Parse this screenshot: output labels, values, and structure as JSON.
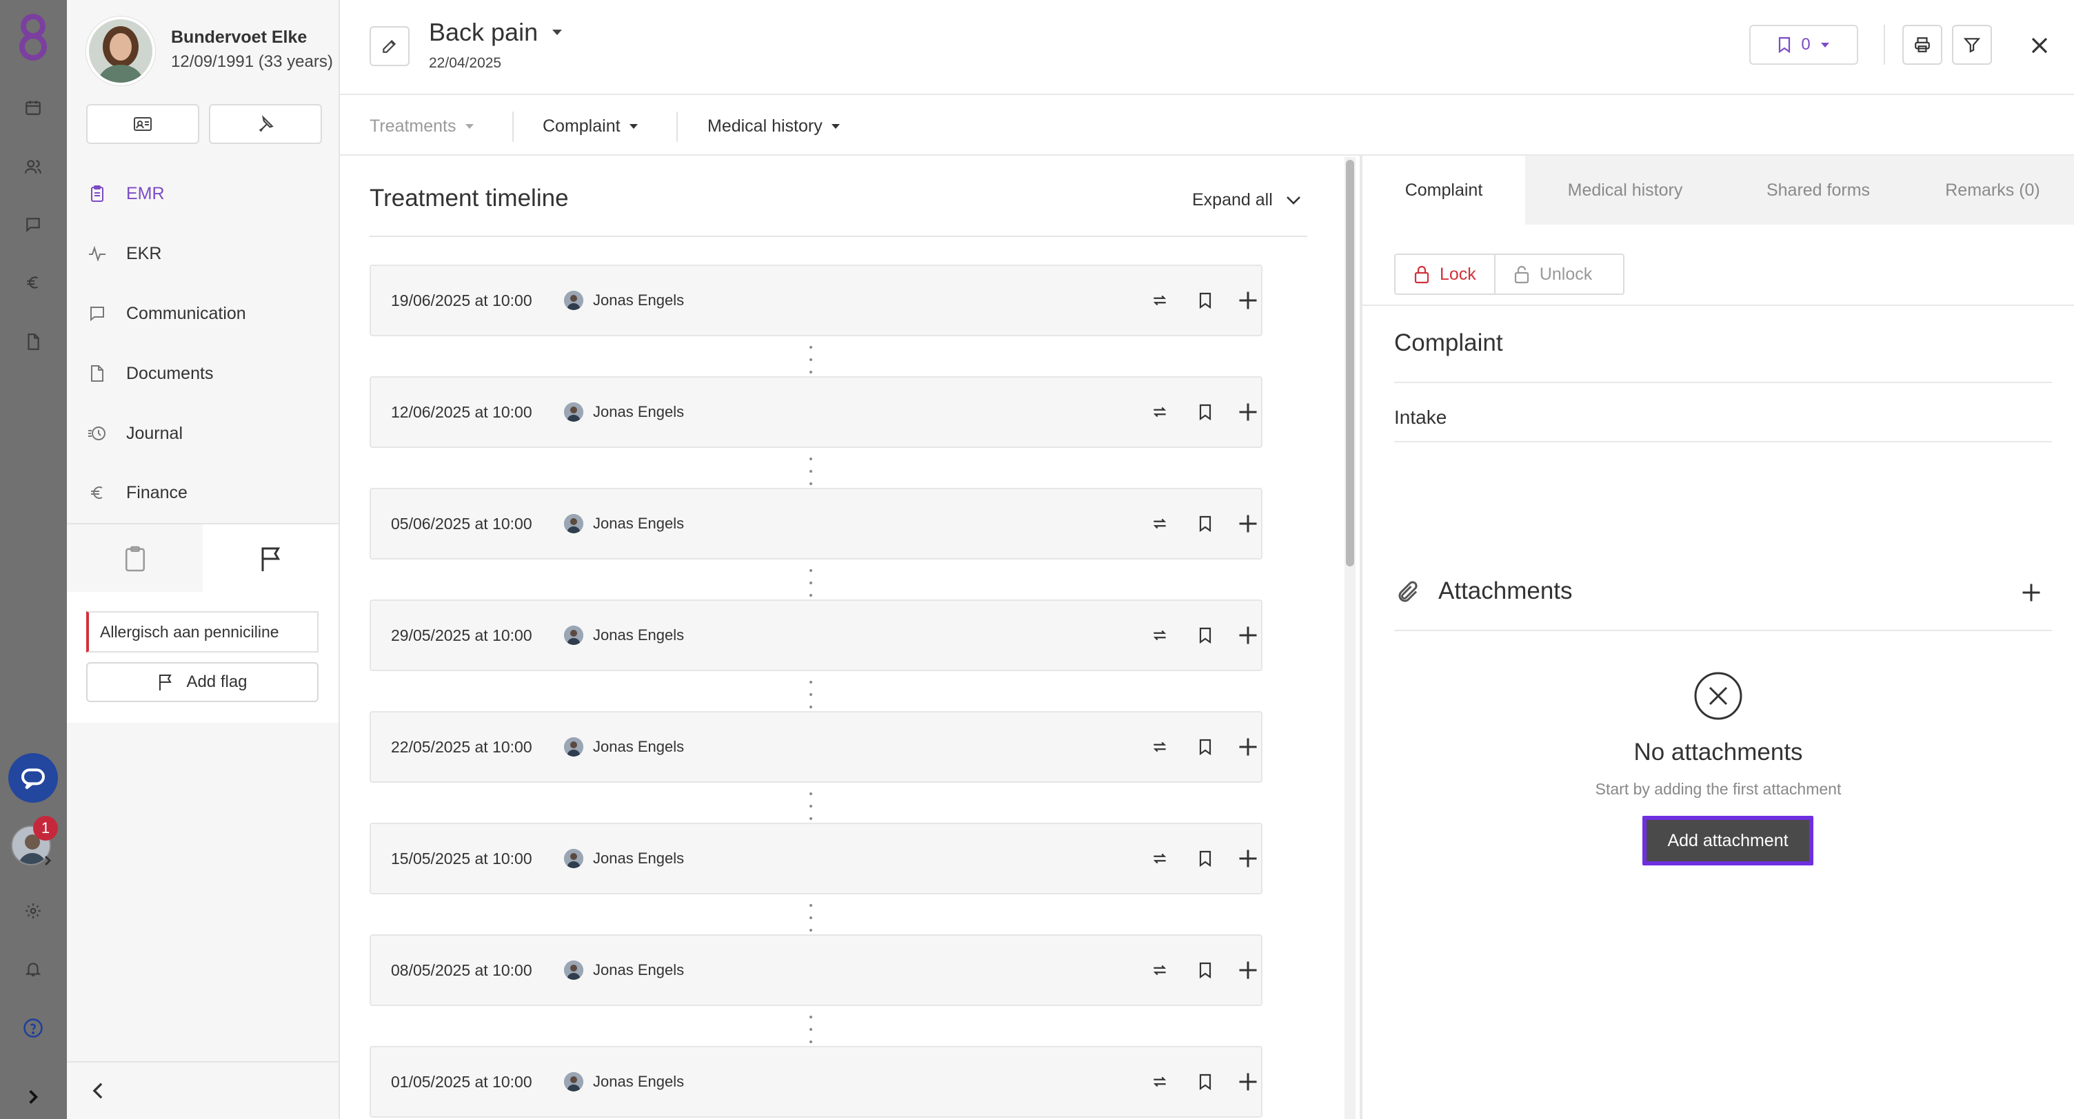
{
  "patient": {
    "name": "Bundervoet Elke",
    "dob": "12/09/1991 (33 years)"
  },
  "nav": [
    {
      "label": "EMR",
      "icon": "clipboard-icon",
      "active": true
    },
    {
      "label": "EKR",
      "icon": "activity-icon"
    },
    {
      "label": "Communication",
      "icon": "message-icon"
    },
    {
      "label": "Documents",
      "icon": "document-icon"
    },
    {
      "label": "Journal",
      "icon": "history-icon"
    },
    {
      "label": "Finance",
      "icon": "euro-icon"
    }
  ],
  "flags": {
    "item": "Allergisch aan penniciline",
    "add_label": "Add flag"
  },
  "rail": {
    "notification_count": "1"
  },
  "episode": {
    "title": "Back pain",
    "date": "22/04/2025",
    "bookmark_count": "0"
  },
  "filters": {
    "treatments": "Treatments",
    "complaint": "Complaint",
    "medical_history": "Medical history"
  },
  "timeline": {
    "title": "Treatment timeline",
    "expand_label": "Expand all",
    "items": [
      {
        "date": "19/06/2025 at 10:00",
        "practitioner": "Jonas Engels"
      },
      {
        "date": "12/06/2025 at 10:00",
        "practitioner": "Jonas Engels"
      },
      {
        "date": "05/06/2025 at 10:00",
        "practitioner": "Jonas Engels"
      },
      {
        "date": "29/05/2025 at 10:00",
        "practitioner": "Jonas Engels"
      },
      {
        "date": "22/05/2025 at 10:00",
        "practitioner": "Jonas Engels"
      },
      {
        "date": "15/05/2025 at 10:00",
        "practitioner": "Jonas Engels"
      },
      {
        "date": "08/05/2025 at 10:00",
        "practitioner": "Jonas Engels"
      },
      {
        "date": "01/05/2025 at 10:00",
        "practitioner": "Jonas Engels"
      }
    ]
  },
  "right": {
    "tabs": [
      "Complaint",
      "Medical history",
      "Shared forms",
      "Remarks (0)"
    ],
    "lock": "Lock",
    "unlock": "Unlock",
    "complaint_title": "Complaint",
    "complaint_text": "Intake",
    "attachments_title": "Attachments",
    "empty_title": "No attachments",
    "empty_sub": "Start by adding the first attachment",
    "add_attachment": "Add attachment"
  },
  "colors": {
    "accent": "#7c4cc4",
    "flag_red": "#d0313b",
    "lock_red": "#d0313b",
    "highlight": "#6f2fe0"
  }
}
